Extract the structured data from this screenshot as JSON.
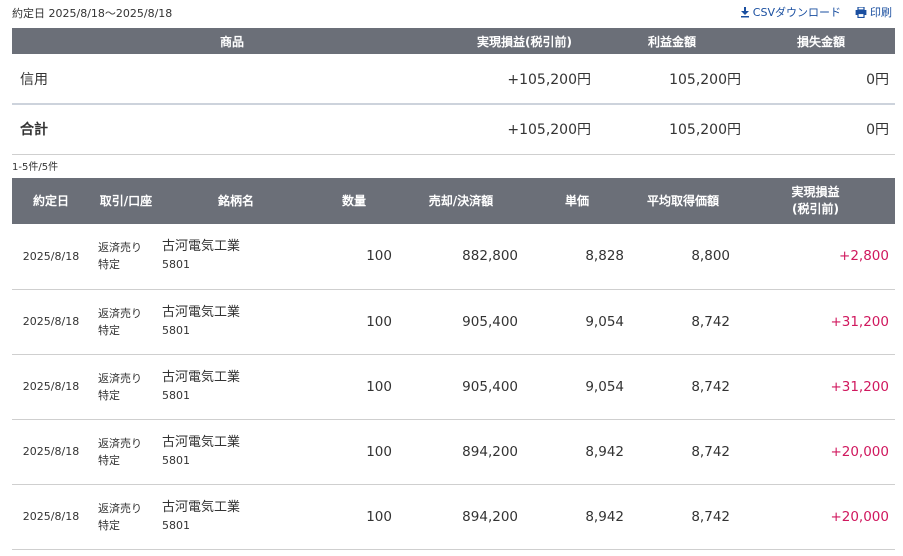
{
  "header": {
    "date_range": "約定日 2025/8/18〜2025/8/18",
    "csv_label": "CSVダウンロード",
    "csv_icon": "download-icon",
    "print_label": "印刷",
    "print_icon": "printer-icon"
  },
  "summary": {
    "columns": [
      "商品",
      "実現損益(税引前)",
      "利益金額",
      "損失金額"
    ],
    "rows": [
      {
        "product": "信用",
        "realized": "+105,200円",
        "profit": "105,200円",
        "loss": "0円"
      },
      {
        "product": "合計",
        "realized": "+105,200円",
        "profit": "105,200円",
        "loss": "0円"
      }
    ]
  },
  "count_label": "1-5件/5件",
  "detail": {
    "columns": [
      "約定日",
      "取引/口座",
      "銘柄名",
      "数量",
      "売却/決済額",
      "単価",
      "平均取得価額",
      "実現損益",
      "(税引前)"
    ],
    "rows": [
      {
        "date": "2025/8/18",
        "trade": "返済売り",
        "account": "特定",
        "name": "古河電気工業",
        "code": "5801",
        "qty": "100",
        "amount": "882,800",
        "price": "8,828",
        "avg": "8,800",
        "pl": "+2,800"
      },
      {
        "date": "2025/8/18",
        "trade": "返済売り",
        "account": "特定",
        "name": "古河電気工業",
        "code": "5801",
        "qty": "100",
        "amount": "905,400",
        "price": "9,054",
        "avg": "8,742",
        "pl": "+31,200"
      },
      {
        "date": "2025/8/18",
        "trade": "返済売り",
        "account": "特定",
        "name": "古河電気工業",
        "code": "5801",
        "qty": "100",
        "amount": "905,400",
        "price": "9,054",
        "avg": "8,742",
        "pl": "+31,200"
      },
      {
        "date": "2025/8/18",
        "trade": "返済売り",
        "account": "特定",
        "name": "古河電気工業",
        "code": "5801",
        "qty": "100",
        "amount": "894,200",
        "price": "8,942",
        "avg": "8,742",
        "pl": "+20,000"
      },
      {
        "date": "2025/8/18",
        "trade": "返済売り",
        "account": "特定",
        "name": "古河電気工業",
        "code": "5801",
        "qty": "100",
        "amount": "894,200",
        "price": "8,942",
        "avg": "8,742",
        "pl": "+20,000"
      }
    ]
  },
  "colors": {
    "header_bg": "#6b6f78",
    "positive": "#d0185e",
    "link": "#1a4fa0"
  }
}
